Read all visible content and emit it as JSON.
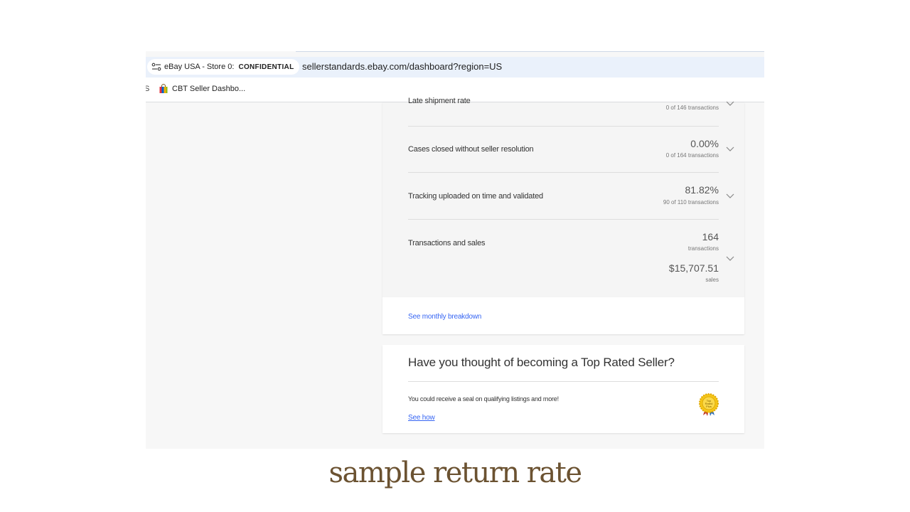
{
  "browser": {
    "site_name": "eBay USA - Store 0:",
    "badge": "CONFIDENTIAL",
    "url": "sellerstandards.ebay.com/dashboard?region=US",
    "bookmark_cut": "S",
    "bookmark": "CBT Seller Dashbo..."
  },
  "metrics": [
    {
      "label": "Late shipment rate",
      "value": "",
      "sub": "0 of 146 transactions"
    },
    {
      "label": "Cases closed without seller resolution",
      "value": "0.00%",
      "sub": "0 of 164 transactions"
    },
    {
      "label": "Tracking uploaded on time and validated",
      "value": "81.82%",
      "sub": "90 of 110 transactions"
    },
    {
      "label": "Transactions and sales",
      "value": "164",
      "sub": "transactions",
      "value2": "$15,707.51",
      "sub2": "sales"
    }
  ],
  "breakdown_link": "See monthly breakdown",
  "top_rated": {
    "title": "Have you thought of becoming a Top Rated Seller?",
    "body": "You could receive a seal on qualifying listings and more!",
    "link": "See how",
    "seal_text": "Top Rated Plus"
  },
  "caption": "sample return rate",
  "colors": {
    "link": "#3665f3",
    "caption": "#6b5231",
    "address_bar": "#eaf1fb"
  }
}
